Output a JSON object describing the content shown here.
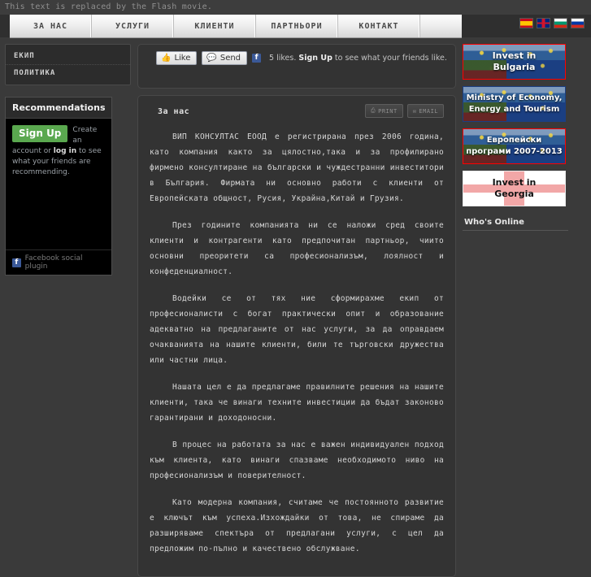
{
  "flash_note": "This text is replaced by the Flash movie.",
  "nav": {
    "items": [
      {
        "label": "ЗА НАС"
      },
      {
        "label": "УСЛУГИ"
      },
      {
        "label": "КЛИЕНТИ"
      },
      {
        "label": "ПАРТНЬОРИ"
      },
      {
        "label": "КОНТАКТ"
      }
    ]
  },
  "flags": [
    {
      "name": "spanish-flag",
      "code": "es"
    },
    {
      "name": "english-flag",
      "code": "gb"
    },
    {
      "name": "bulgarian-flag",
      "code": "bg"
    },
    {
      "name": "russian-flag",
      "code": "ru"
    }
  ],
  "sidebar": {
    "menu": [
      {
        "label": "ЕКИП"
      },
      {
        "label": "ПОЛИТИКА"
      }
    ],
    "facebook": {
      "title": "Recommendations",
      "signup_label": "Sign Up",
      "body_lead": "Create an account or ",
      "body_link": "log in",
      "body_tail": " to see what your friends are recommending.",
      "footer": "Facebook social plugin",
      "f_glyph": "f"
    }
  },
  "social": {
    "like_label": "Like",
    "like_icon": "thumbs-up-icon",
    "send_label": "Send",
    "send_icon": "speech-bubble-icon",
    "f_glyph": "f",
    "likes_count": "5 likes.",
    "signup_label": "Sign Up",
    "likes_tail": " to see what your friends like."
  },
  "article": {
    "title": "За нас",
    "print_label": "PRINT",
    "print_icon": "printer-icon",
    "email_label": "EMAIL",
    "email_icon": "envelope-icon",
    "paragraphs": [
      "ВИП КОНСУЛТАС ЕООД    е регистрирана през  2006 година,  като компания както за цялостно,така и за профилирано фирмено консултиране на български и чуждестранни инвеститори в България. Фирмата ни основно работи с клиенти от Европейската общност, Русия, Украйна,Китай и Грузия.",
      "През годините компанията ни се наложи сред своите клиенти и контрагенти като предпочитан партньор,  чиито основни преоритети са професионализъм,  лоялност и конфеденциалност.",
      "Водейки се от тях ние сформирахме екип от професионалисти с богат практически опит и образование адекватно    на предлаганите от нас услуги, за да оправдаем    очакванията на нашите клиенти, били те търговски дружества или частни лица.",
      "Нашата цел е да предлагаме правилните решения на нашите клиенти, така че винаги техните инвестиции да бъдат законово гарантирани и доходоносни.",
      "В процес на работата за нас е важен индивидуален подход към клиента, като винаги спазваме необходимото ниво на професионализъм и поверителност.",
      "Като модерна компания, считаме че постоянното развитие е ключът към успеха.Изхождайки от това, не спираме да разширяваме спектъра от предлагани    услуги, с цел да предложим по-пълно и качествено обслужване."
    ]
  },
  "banners": [
    {
      "name": "invest-in-bulgaria-banner",
      "line1": "Invest in",
      "line2": "Bulgaria",
      "style": "eu",
      "framed": true
    },
    {
      "name": "ministry-of-economy-banner",
      "line1": "Ministry of Economy,",
      "line2": "Energy  and Tourism",
      "style": "eu",
      "framed": false
    },
    {
      "name": "european-programmes-banner",
      "line1": "Европейски",
      "line2": "програми 2007-2013",
      "style": "eu",
      "framed": true
    },
    {
      "name": "invest-in-georgia-banner",
      "line1": "Invest in",
      "line2": "Georgia",
      "style": "ge",
      "framed": false
    }
  ],
  "right": {
    "whos_online_title": "Who's Online"
  },
  "colors": {
    "page_bg": "#3a3a3a",
    "panel_bg": "#333333",
    "accent_green": "#5aa84f",
    "facebook_blue": "#3b5998",
    "banner_frame": "#ff0000"
  }
}
